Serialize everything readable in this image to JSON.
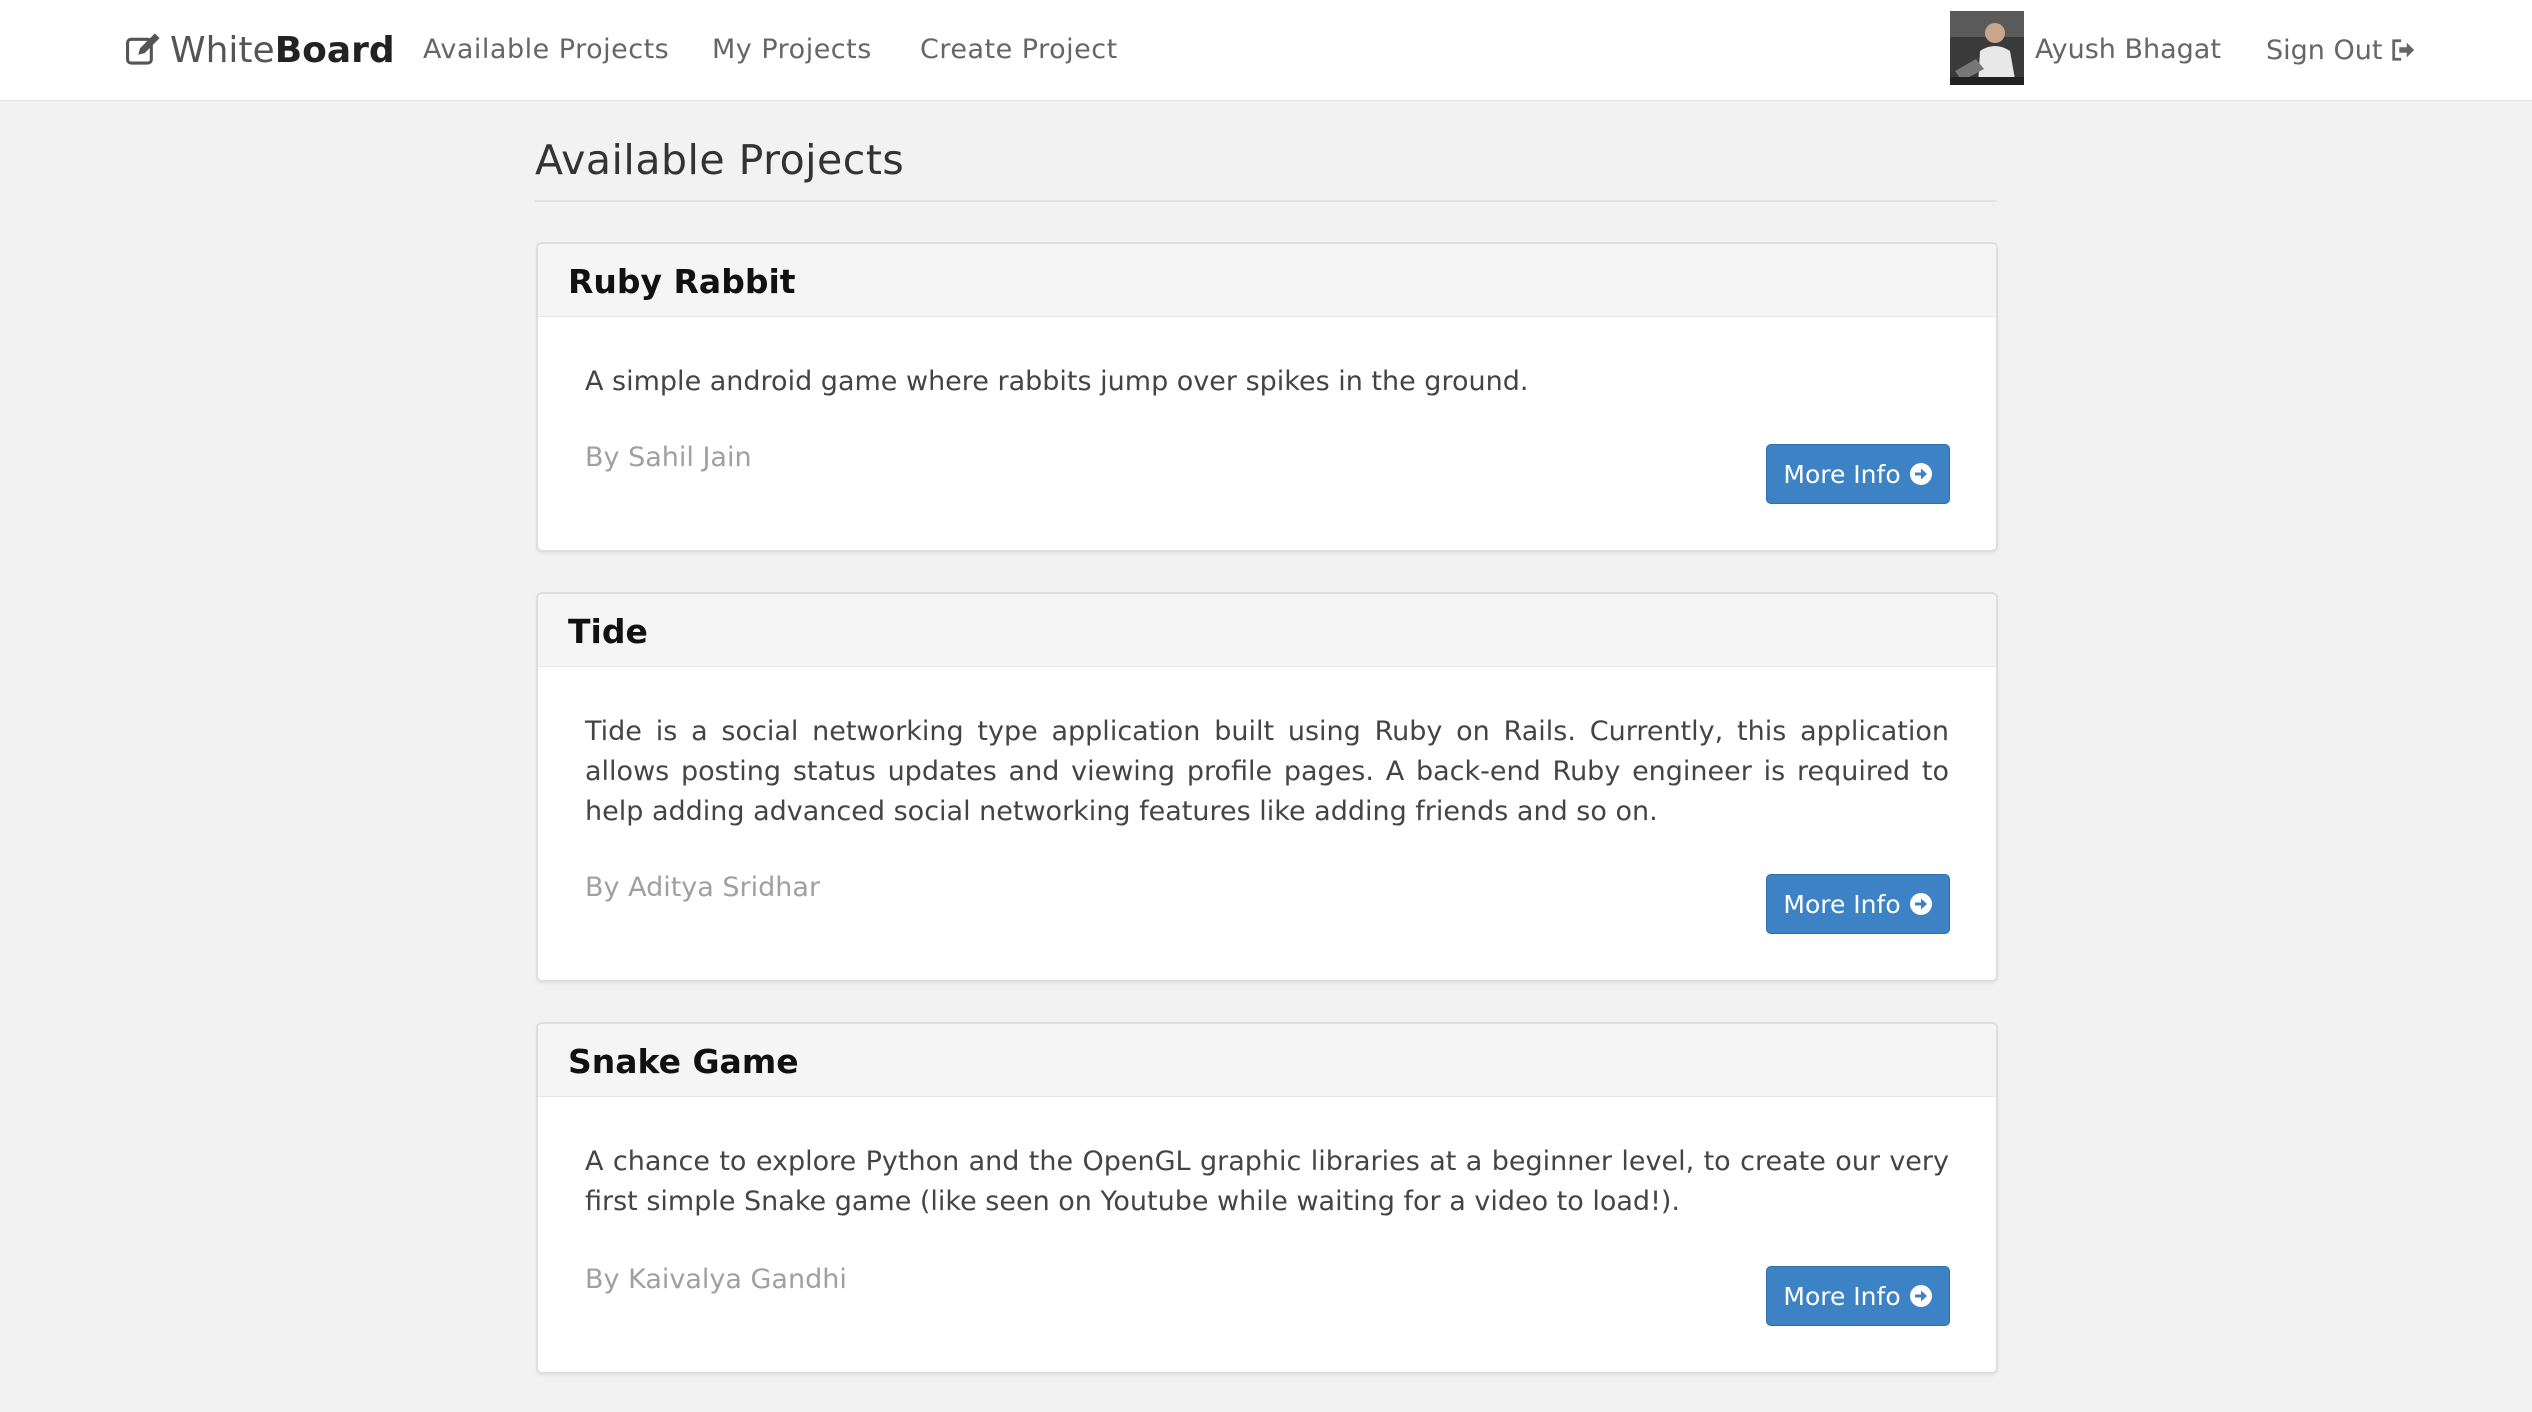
{
  "navbar": {
    "brand_light": "White",
    "brand_bold": "Board",
    "links": [
      "Available Projects",
      "My Projects",
      "Create Project"
    ],
    "user_name": "Ayush Bhagat",
    "signout_label": "Sign Out"
  },
  "page": {
    "title": "Available Projects"
  },
  "projects": [
    {
      "title": "Ruby Rabbit",
      "description": "A simple android game where rabbits jump over spikes in the ground.",
      "author": "By Sahil Jain",
      "button": "More Info"
    },
    {
      "title": "Tide",
      "description": "Tide is a social networking type application built using Ruby on Rails. Currently, this application allows posting status updates and viewing profile pages. A back-end Ruby engineer is required to help adding advanced social networking features like adding friends and so on.",
      "author": "By Aditya Sridhar",
      "button": "More Info"
    },
    {
      "title": "Snake Game",
      "description": "A chance to explore Python and the OpenGL graphic libraries at a beginner level, to create our very first simple Snake game (like seen on Youtube while waiting for a video to load!).",
      "author": "By Kaivalya Gandhi",
      "button": "More Info"
    }
  ],
  "colors": {
    "background": "#f2f2f2",
    "button": "#3d82c4",
    "card_header": "#f5f5f5"
  },
  "icons": {
    "brand": "edit-icon",
    "signout": "sign-out-icon",
    "more_info": "arrow-circle-right-icon"
  }
}
